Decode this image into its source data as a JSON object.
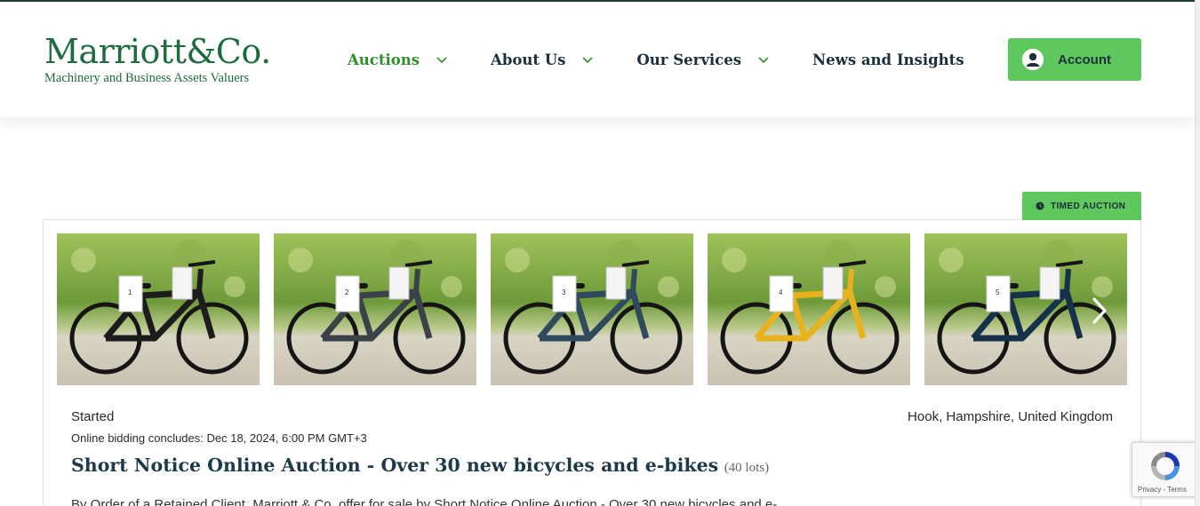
{
  "header": {
    "logo": {
      "name": "Marriott&Co.",
      "tagline": "Machinery and Business Assets Valuers"
    },
    "nav": [
      {
        "label": "Auctions",
        "has_dropdown": true,
        "active": true
      },
      {
        "label": "About Us",
        "has_dropdown": true,
        "active": false
      },
      {
        "label": "Our Services",
        "has_dropdown": true,
        "active": false
      },
      {
        "label": "News and Insights",
        "has_dropdown": false,
        "active": false
      }
    ],
    "account_label": "Account"
  },
  "auction": {
    "badge": "TIMED AUCTION",
    "status": "Started",
    "location": "Hook, Hampshire, United Kingdom",
    "concludes": "Online bidding concludes: Dec 18, 2024, 6:00 PM GMT+3",
    "title": "Short Notice Online Auction - Over 30 new bicycles and e-bikes",
    "lots": "(40 lots)",
    "description": "By Order of a Retained Client, Marriott & Co. offer for sale by Short Notice Online Auction - Over 30 new bicycles and e-",
    "images": [
      {
        "lot": "1",
        "frame": "#1c1c1c"
      },
      {
        "lot": "2",
        "frame": "#3b4247"
      },
      {
        "lot": "3",
        "frame": "#2e4a5c"
      },
      {
        "lot": "4",
        "frame": "#e8b21c"
      },
      {
        "lot": "5",
        "frame": "#16324a"
      }
    ]
  },
  "recaptcha": {
    "links": "Privacy - Terms"
  },
  "colors": {
    "brand_green": "#1e6b3f",
    "accent_green": "#5ec85e",
    "nav_active": "#2f8f2c",
    "title_navy": "#1c3a4a"
  },
  "icons": [
    "chevron-down-icon",
    "user-icon",
    "clock-icon",
    "chevron-right-icon",
    "recaptcha-icon"
  ]
}
